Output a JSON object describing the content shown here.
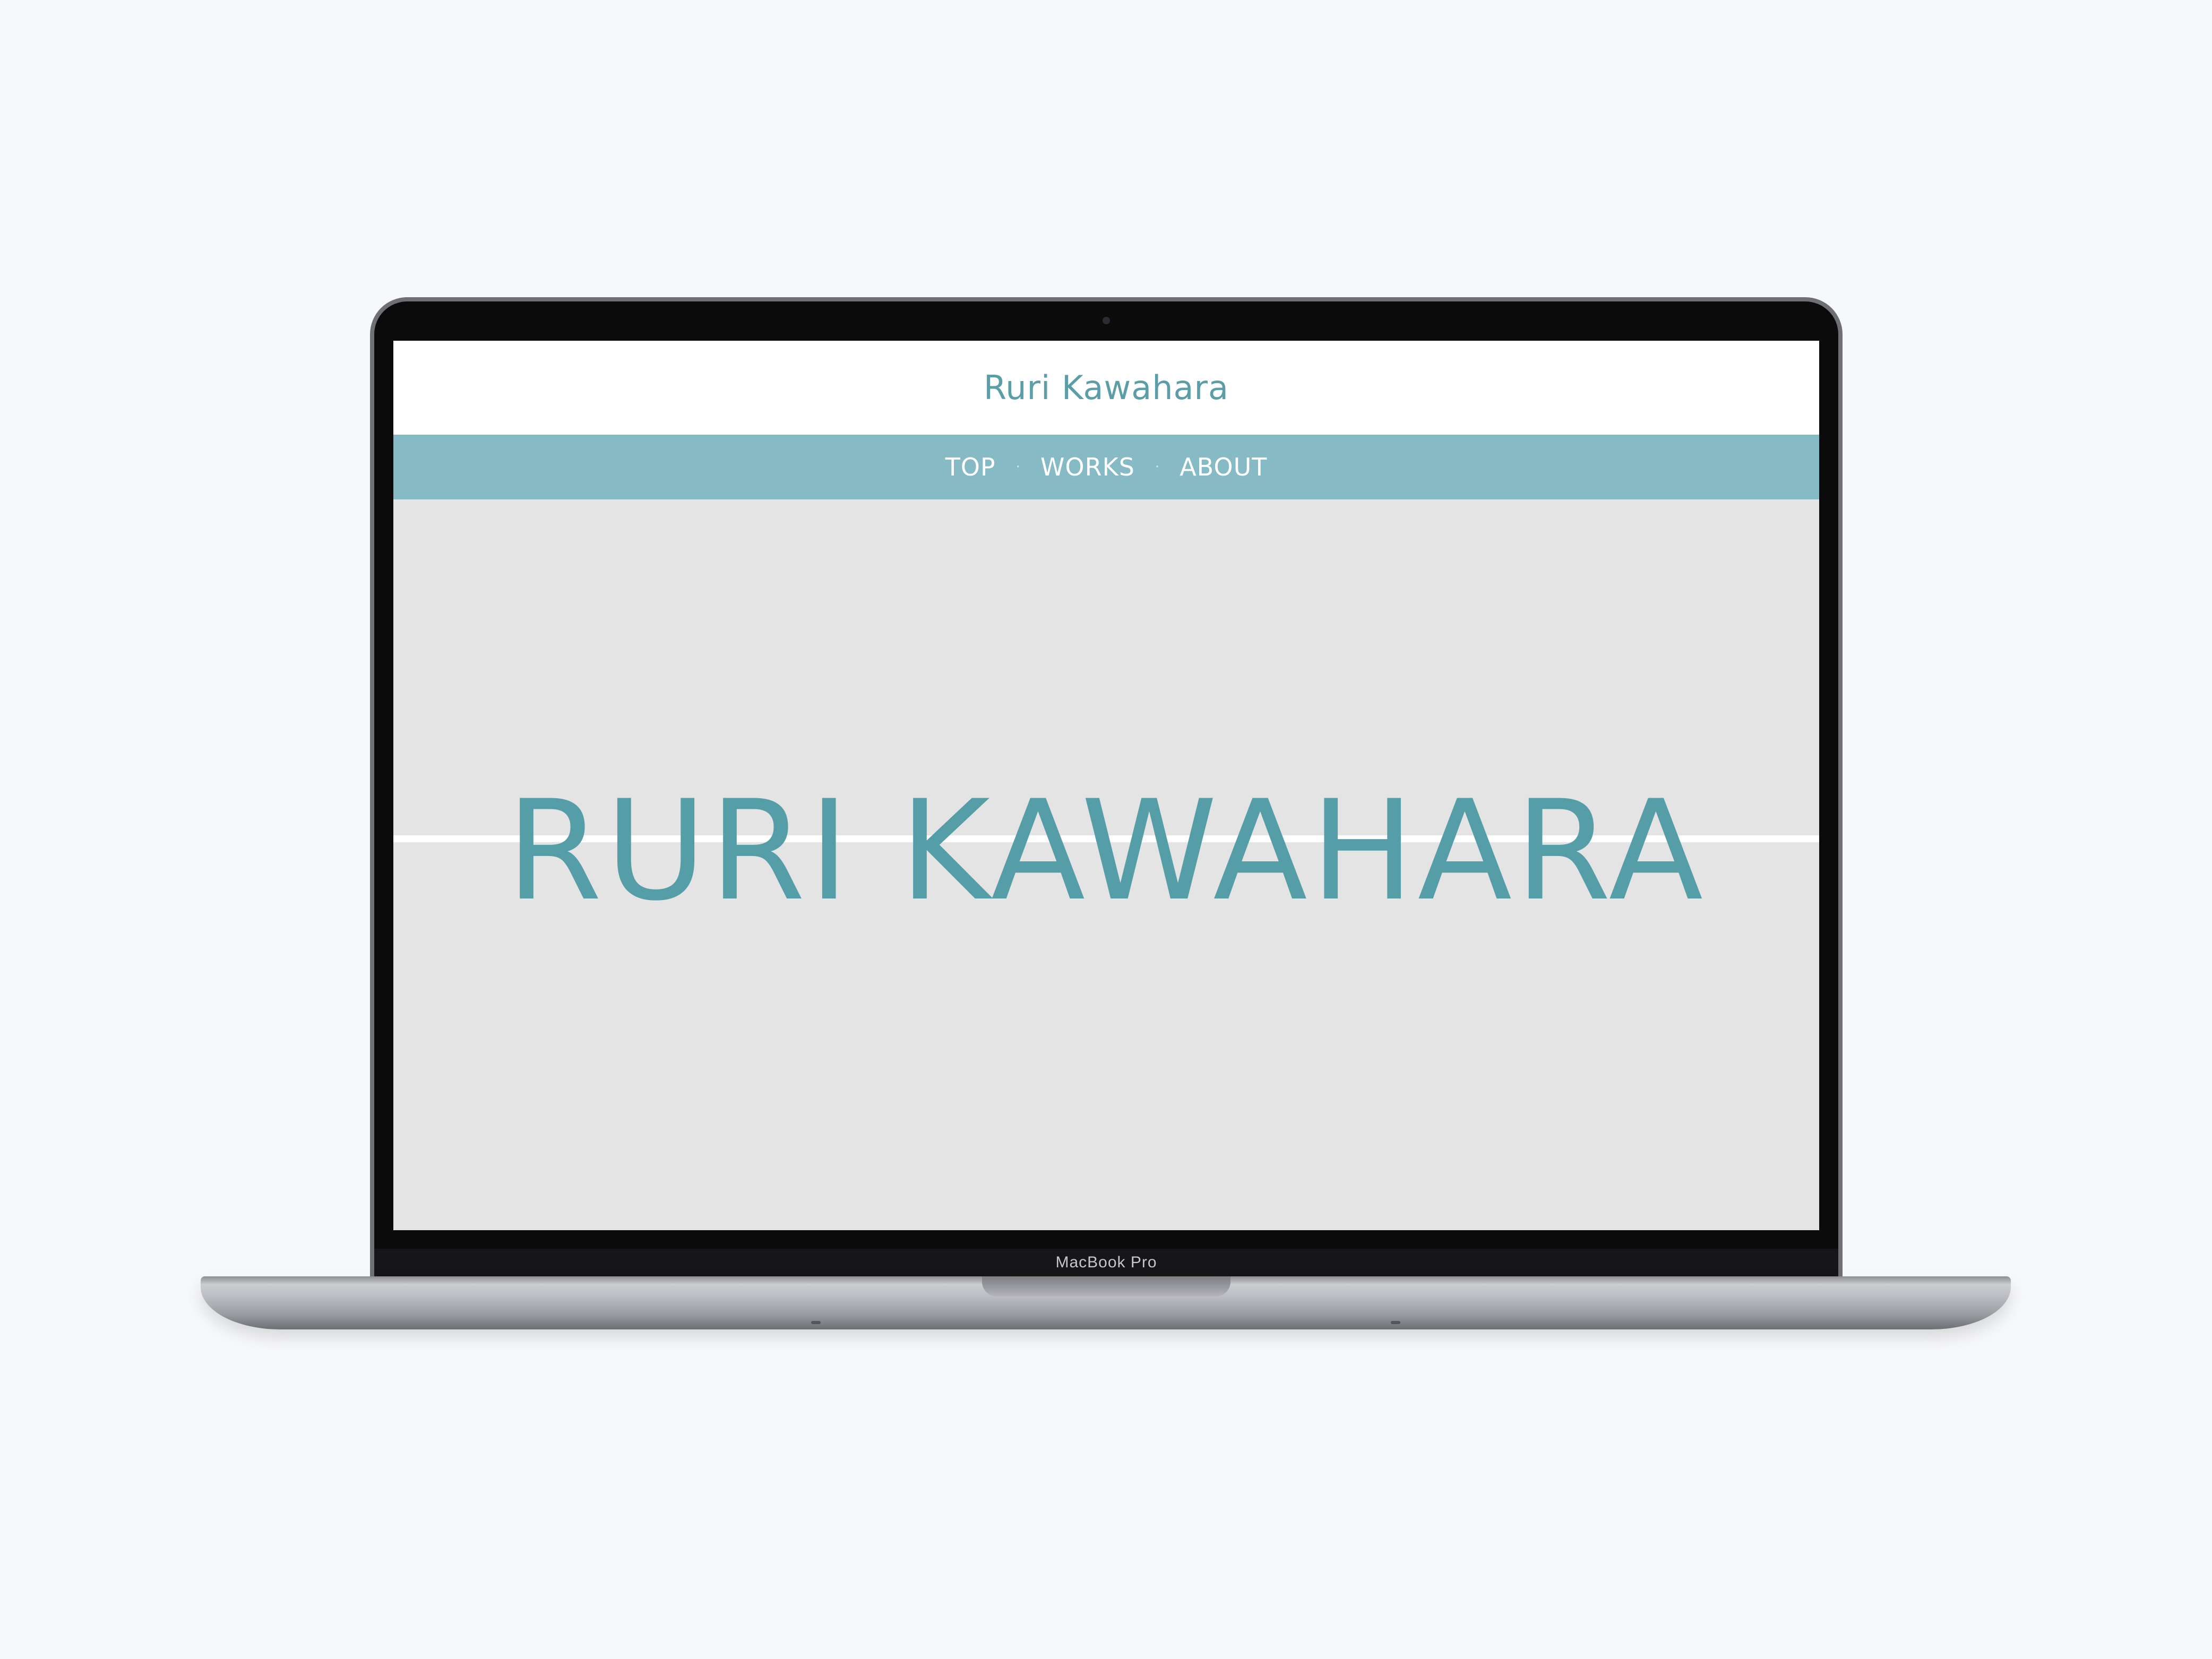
{
  "site": {
    "header_title": "Ruri Kawahara",
    "nav": [
      {
        "label": "TOP"
      },
      {
        "label": "WORKS"
      },
      {
        "label": "ABOUT"
      }
    ],
    "nav_separator": "·",
    "hero_title": "RURI KAWAHARA"
  },
  "device": {
    "model_label": "MacBook Pro"
  },
  "colors": {
    "brand_teal": "#559ea8",
    "nav_background": "#86bac4",
    "hero_background": "#e4e4e4",
    "page_background": "#f7f8fa"
  }
}
